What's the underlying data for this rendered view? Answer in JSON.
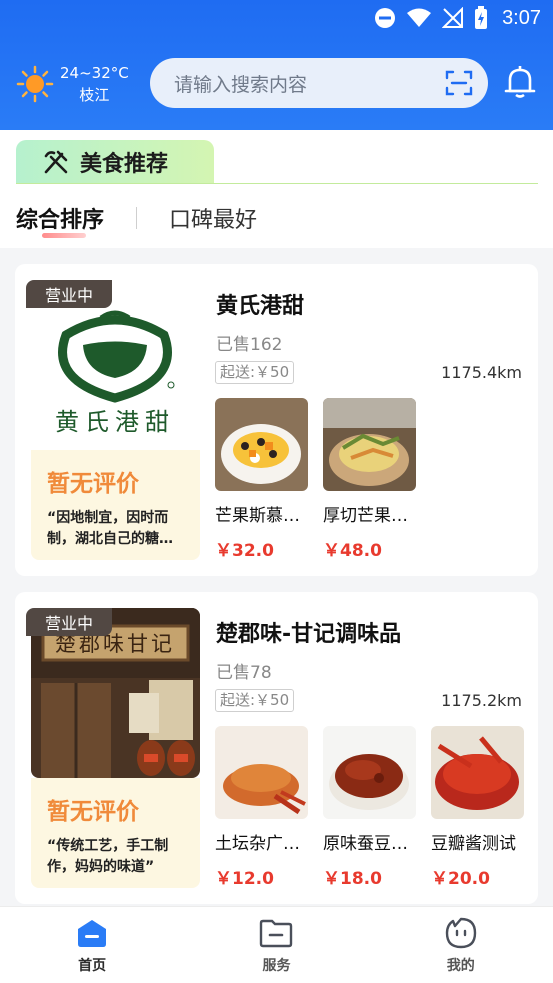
{
  "status_bar": {
    "time": "3:07"
  },
  "weather": {
    "temp": "24~32°C",
    "city": "枝江"
  },
  "search": {
    "placeholder": "请输入搜索内容"
  },
  "section": {
    "title": "美食推荐",
    "sort_options": [
      "综合排序",
      "口碑最好"
    ],
    "active_sort": "综合排序"
  },
  "shops": [
    {
      "status": "营业中",
      "name": "黄氏港甜",
      "logo_text": "黄氏港甜",
      "sold": "已售162",
      "min_delivery": "起送:￥50",
      "distance": "1175.4km",
      "review_title": "暂无评价",
      "review_desc": "“因地制宜，因时而制，湖北自己的糖水…",
      "dishes": [
        {
          "name": "芒果斯慕…",
          "price": "￥32.0"
        },
        {
          "name": "厚切芒果…",
          "price": "￥48.0"
        }
      ]
    },
    {
      "status": "营业中",
      "name": "楚郡味-甘记调味品",
      "sign_text": "楚郡味甘记",
      "sold": "已售78",
      "min_delivery": "起送:￥50",
      "distance": "1175.2km",
      "review_title": "暂无评价",
      "review_desc": "“传统工艺，手工制作，妈妈的味道”",
      "dishes": [
        {
          "name": "土坛杂广…",
          "price": "￥12.0"
        },
        {
          "name": "原味蚕豆…",
          "price": "￥18.0"
        },
        {
          "name": "豆瓣酱测试",
          "price": "￥20.0"
        }
      ]
    }
  ],
  "bottom_nav": [
    {
      "label": "首页",
      "icon": "home-icon",
      "active": true
    },
    {
      "label": "服务",
      "icon": "folder-icon",
      "active": false
    },
    {
      "label": "我的",
      "icon": "profile-icon",
      "active": false
    }
  ],
  "colors": {
    "header_blue": "#1f6cf2",
    "price_red": "#e83a2e",
    "review_orange": "#f08a3a",
    "nav_active_blue": "#2a7cf6"
  }
}
